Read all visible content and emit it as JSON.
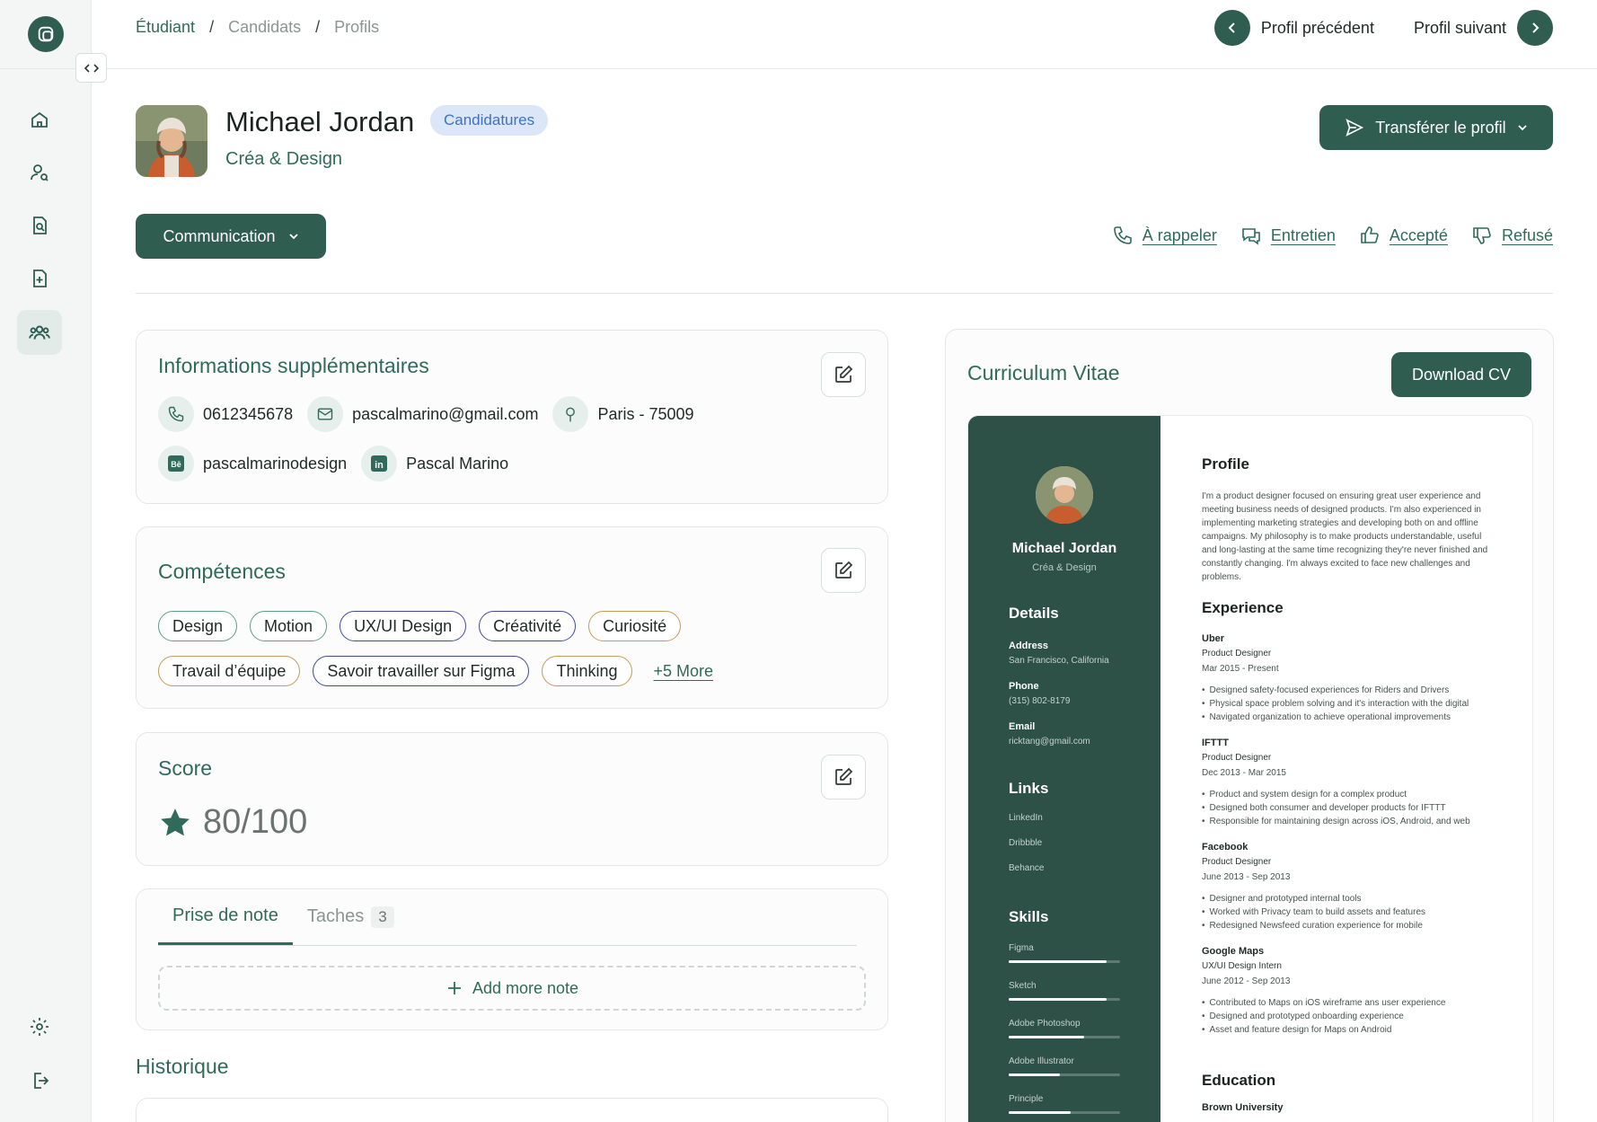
{
  "breadcrumb": [
    "Étudiant",
    "Candidats",
    "Profils"
  ],
  "pager": {
    "prev_label": "Profil précédent",
    "next_label": "Profil suivant"
  },
  "profile": {
    "name": "Michael Jordan",
    "badge": "Candidatures",
    "subtitle": "Créa & Design",
    "transfer_label": "Transférer le profil",
    "category_label": "Communication"
  },
  "status_actions": [
    {
      "label": "À rappeler",
      "icon": "phone-icon"
    },
    {
      "label": "Entretien",
      "icon": "chat-icon"
    },
    {
      "label": "Accepté",
      "icon": "thumbs-up-icon"
    },
    {
      "label": "Refusé",
      "icon": "thumbs-down-icon"
    }
  ],
  "info": {
    "title": "Informations supplémentaires",
    "phone": "0612345678",
    "email": "pascalmarino@gmail.com",
    "location": "Paris - 75009",
    "behance": "pascalmarinodesign",
    "linkedin": "Pascal Marino"
  },
  "skills": {
    "title": "Compétences",
    "row1": [
      {
        "label": "Design",
        "color": "green"
      },
      {
        "label": "Motion",
        "color": "green"
      },
      {
        "label": "UX/UI Design",
        "color": "blue"
      },
      {
        "label": "Créativité",
        "color": "blue"
      },
      {
        "label": "Curiosité",
        "color": "orange"
      }
    ],
    "row2": [
      {
        "label": "Travail d’équipe",
        "color": "orange"
      },
      {
        "label": "Savoir travailler sur Figma",
        "color": "blue"
      },
      {
        "label": "Thinking",
        "color": "orange"
      }
    ],
    "more": "+5 More"
  },
  "score": {
    "title": "Score",
    "value": "80/100"
  },
  "notes": {
    "tab_notes": "Prise de note",
    "tab_tasks": "Taches",
    "tasks_count": "3",
    "add_label": "Add more note"
  },
  "history_title": "Historique",
  "cv": {
    "title": "Curriculum Vitae",
    "download": "Download CV",
    "name": "Michael Jordan",
    "role": "Créa & Design",
    "details_title": "Details",
    "address_label": "Address",
    "address": "San Francisco, California",
    "phone_label": "Phone",
    "phone": "(315) 802-8179",
    "email_label": "Email",
    "email": "ricktang@gmail.com",
    "links_title": "Links",
    "links": [
      "LinkedIn",
      "Dribbble",
      "Behance"
    ],
    "skills_title": "Skills",
    "skills": [
      {
        "name": "Figma",
        "level": 0.88
      },
      {
        "name": "Sketch",
        "level": 0.88
      },
      {
        "name": "Adobe Photoshop",
        "level": 0.68
      },
      {
        "name": "Adobe Illustrator",
        "level": 0.46
      },
      {
        "name": "Principle",
        "level": 0.56
      }
    ],
    "profile_title": "Profile",
    "profile_text": "I'm a product designer focused on ensuring great user experience and meeting business needs of designed products. I'm also experienced in implementing marketing strategies and developing both on and offline campaigns. My philosophy is to make products understandable, useful and long-lasting at the same time recognizing they're never finished and constantly changing. I'm always excited to face new challenges and problems.",
    "experience_title": "Experience",
    "experience": [
      {
        "company": "Uber",
        "position": "Product Designer",
        "dates": "Mar 2015 - Present",
        "bullets": [
          "Designed safety-focused experiences for Riders and Drivers",
          "Physical space problem solving and it's interaction with the digital",
          "Navigated organization to achieve operational improvements"
        ]
      },
      {
        "company": "IFTTT",
        "position": "Product Designer",
        "dates": "Dec 2013 - Mar 2015",
        "bullets": [
          "Product and system design for a complex product",
          "Designed both consumer and developer products for IFTTT",
          "Responsible for maintaining design across iOS, Android, and web"
        ]
      },
      {
        "company": "Facebook",
        "position": "Product Designer",
        "dates": "June 2013 - Sep 2013",
        "bullets": [
          "Designer and prototyped internal tools",
          "Worked with Privacy team to build assets and features",
          "Redesigned Newsfeed curation experience for mobile"
        ]
      },
      {
        "company": "Google Maps",
        "position": "UX/UI Design Intern",
        "dates": "June 2012 - Sep 2013",
        "bullets": [
          "Contributed to Maps on iOS wireframe ans user experience",
          "Designed and prototyped onboarding experience",
          "Asset and feature design for Maps on Android"
        ]
      }
    ],
    "education_title": "Education",
    "education_school": "Brown University"
  },
  "colors": {
    "primary": "#2f5d50",
    "accent_text": "#2f6b58",
    "badge_bg": "#dbe6f6",
    "badge_text": "#3b73c7"
  }
}
